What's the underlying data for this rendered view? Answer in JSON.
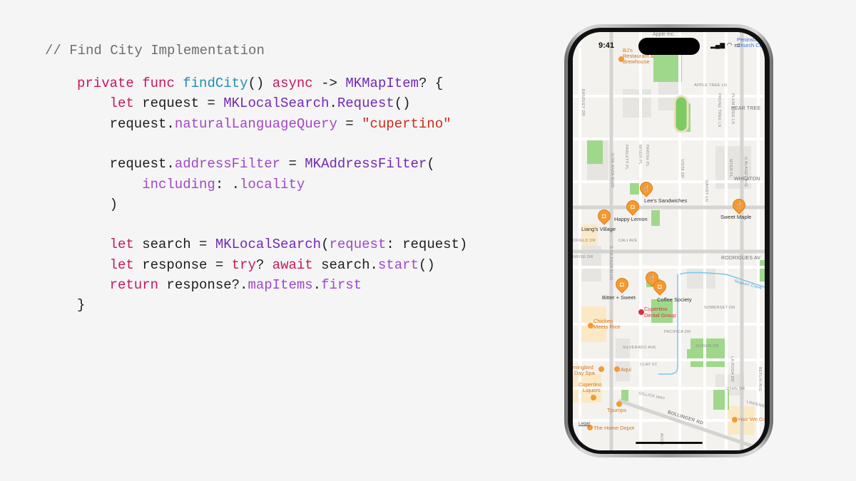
{
  "code": {
    "comment": "// Find City Implementation",
    "lines": [
      {
        "indent": 1,
        "tokens": [
          [
            "kw",
            "private"
          ],
          [
            "pl",
            " "
          ],
          [
            "kw",
            "func"
          ],
          [
            "pl",
            " "
          ],
          [
            "fn",
            "findCity"
          ],
          [
            "pl",
            "() "
          ],
          [
            "kw",
            "async"
          ],
          [
            "pl",
            " -> "
          ],
          [
            "ty",
            "MKMapItem"
          ],
          [
            "pl",
            "? {"
          ]
        ]
      },
      {
        "indent": 2,
        "tokens": [
          [
            "kw",
            "let"
          ],
          [
            "pl",
            " request = "
          ],
          [
            "ty",
            "MKLocalSearch"
          ],
          [
            "pl",
            "."
          ],
          [
            "ty",
            "Request"
          ],
          [
            "pl",
            "()"
          ]
        ]
      },
      {
        "indent": 2,
        "tokens": [
          [
            "pl",
            "request."
          ],
          [
            "pr",
            "naturalLanguageQuery"
          ],
          [
            "pl",
            " = "
          ],
          [
            "st",
            "\"cupertino\""
          ]
        ]
      },
      {
        "indent": 0,
        "tokens": []
      },
      {
        "indent": 2,
        "tokens": [
          [
            "pl",
            "request."
          ],
          [
            "pr",
            "addressFilter"
          ],
          [
            "pl",
            " = "
          ],
          [
            "ty",
            "MKAddressFilter"
          ],
          [
            "pl",
            "("
          ]
        ]
      },
      {
        "indent": 3,
        "tokens": [
          [
            "pr",
            "including"
          ],
          [
            "pl",
            ": ."
          ],
          [
            "pr",
            "locality"
          ]
        ]
      },
      {
        "indent": 2,
        "tokens": [
          [
            "pl",
            ")"
          ]
        ]
      },
      {
        "indent": 0,
        "tokens": []
      },
      {
        "indent": 2,
        "tokens": [
          [
            "kw",
            "let"
          ],
          [
            "pl",
            " search = "
          ],
          [
            "ty",
            "MKLocalSearch"
          ],
          [
            "pl",
            "("
          ],
          [
            "pr",
            "request"
          ],
          [
            "pl",
            ": request)"
          ]
        ]
      },
      {
        "indent": 2,
        "tokens": [
          [
            "kw",
            "let"
          ],
          [
            "pl",
            " response = "
          ],
          [
            "kw",
            "try"
          ],
          [
            "pl",
            "? "
          ],
          [
            "kw",
            "await"
          ],
          [
            "pl",
            " search."
          ],
          [
            "pr",
            "start"
          ],
          [
            "pl",
            "()"
          ]
        ]
      },
      {
        "indent": 2,
        "tokens": [
          [
            "kw",
            "return"
          ],
          [
            "pl",
            " response?."
          ],
          [
            "pr",
            "mapItems"
          ],
          [
            "pl",
            "."
          ],
          [
            "pr",
            "first"
          ]
        ]
      },
      {
        "indent": 1,
        "tokens": [
          [
            "pl",
            "}"
          ]
        ]
      }
    ]
  },
  "phone": {
    "time": "9:41",
    "status_icons": "signal-icon wifi-icon battery-icon",
    "map": {
      "pois": [
        "Lee's Sandwiches",
        "Happy Lemon",
        "Sweet Maple",
        "Liang's Village",
        "Bitter + Sweet",
        "Coffee Society"
      ],
      "places": [
        "Apple Inc.",
        "BJ's",
        "Restaurant &",
        "Brewhouse",
        "Peninsula",
        "Church Center",
        "Cupertino",
        "Dental Group",
        "Chicken",
        "Meets Rice",
        "mingbird",
        "Day Spa",
        "Aqui",
        "Cupertino",
        "Liquors",
        "Tpumps",
        "The Home Depot",
        "Hair We Go",
        "Legal"
      ],
      "streets": [
        "APPLE TREE LN",
        "PRUNE TREE LN",
        "PLUM TREE LN",
        "PEAR TREE",
        "BANDLEY DR",
        "N DE ANZA BLVD",
        "PARLETT PL",
        "MINER PL",
        "PARISH PL",
        "VISTA DR",
        "RANDY LN",
        "MYER PL",
        "N BLANEY AVE",
        "WHEATON",
        "CALI AVE",
        "OFIELD DR",
        "NRISE DR",
        "S DE ANZA BLVD",
        "RODRIGUES AV",
        "Regnart Creek",
        "SOMERSET DR",
        "PACIFICA DR",
        "SILVERADO AVE",
        "SUISUN DR",
        "CLAY ST",
        "LA RODA DR",
        "BETLIN AVE",
        "JOHN DR",
        "GILLICK WAY",
        "LINDENBR",
        "BOLLINGER RD",
        "AVON"
      ]
    }
  },
  "colors": {
    "keyword": "#c8175d",
    "function": "#1f8fb3",
    "type": "#7327b8",
    "property": "#a047c9",
    "string": "#d0281c",
    "pin": "#f39a32"
  }
}
